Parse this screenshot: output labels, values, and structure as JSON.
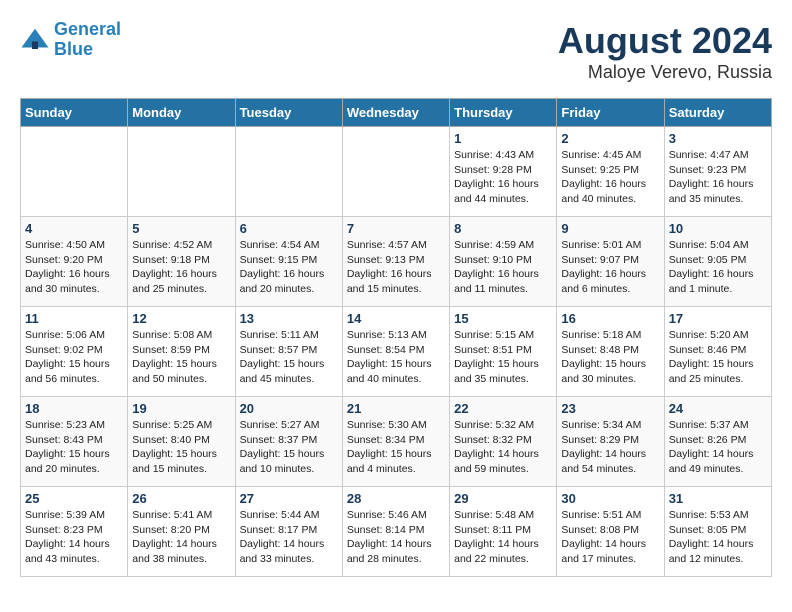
{
  "header": {
    "logo_line1": "General",
    "logo_line2": "Blue",
    "main_title": "August 2024",
    "subtitle": "Maloye Verevo, Russia"
  },
  "days_of_week": [
    "Sunday",
    "Monday",
    "Tuesday",
    "Wednesday",
    "Thursday",
    "Friday",
    "Saturday"
  ],
  "weeks": [
    [
      {
        "day": "",
        "info": ""
      },
      {
        "day": "",
        "info": ""
      },
      {
        "day": "",
        "info": ""
      },
      {
        "day": "",
        "info": ""
      },
      {
        "day": "1",
        "info": "Sunrise: 4:43 AM\nSunset: 9:28 PM\nDaylight: 16 hours\nand 44 minutes."
      },
      {
        "day": "2",
        "info": "Sunrise: 4:45 AM\nSunset: 9:25 PM\nDaylight: 16 hours\nand 40 minutes."
      },
      {
        "day": "3",
        "info": "Sunrise: 4:47 AM\nSunset: 9:23 PM\nDaylight: 16 hours\nand 35 minutes."
      }
    ],
    [
      {
        "day": "4",
        "info": "Sunrise: 4:50 AM\nSunset: 9:20 PM\nDaylight: 16 hours\nand 30 minutes."
      },
      {
        "day": "5",
        "info": "Sunrise: 4:52 AM\nSunset: 9:18 PM\nDaylight: 16 hours\nand 25 minutes."
      },
      {
        "day": "6",
        "info": "Sunrise: 4:54 AM\nSunset: 9:15 PM\nDaylight: 16 hours\nand 20 minutes."
      },
      {
        "day": "7",
        "info": "Sunrise: 4:57 AM\nSunset: 9:13 PM\nDaylight: 16 hours\nand 15 minutes."
      },
      {
        "day": "8",
        "info": "Sunrise: 4:59 AM\nSunset: 9:10 PM\nDaylight: 16 hours\nand 11 minutes."
      },
      {
        "day": "9",
        "info": "Sunrise: 5:01 AM\nSunset: 9:07 PM\nDaylight: 16 hours\nand 6 minutes."
      },
      {
        "day": "10",
        "info": "Sunrise: 5:04 AM\nSunset: 9:05 PM\nDaylight: 16 hours\nand 1 minute."
      }
    ],
    [
      {
        "day": "11",
        "info": "Sunrise: 5:06 AM\nSunset: 9:02 PM\nDaylight: 15 hours\nand 56 minutes."
      },
      {
        "day": "12",
        "info": "Sunrise: 5:08 AM\nSunset: 8:59 PM\nDaylight: 15 hours\nand 50 minutes."
      },
      {
        "day": "13",
        "info": "Sunrise: 5:11 AM\nSunset: 8:57 PM\nDaylight: 15 hours\nand 45 minutes."
      },
      {
        "day": "14",
        "info": "Sunrise: 5:13 AM\nSunset: 8:54 PM\nDaylight: 15 hours\nand 40 minutes."
      },
      {
        "day": "15",
        "info": "Sunrise: 5:15 AM\nSunset: 8:51 PM\nDaylight: 15 hours\nand 35 minutes."
      },
      {
        "day": "16",
        "info": "Sunrise: 5:18 AM\nSunset: 8:48 PM\nDaylight: 15 hours\nand 30 minutes."
      },
      {
        "day": "17",
        "info": "Sunrise: 5:20 AM\nSunset: 8:46 PM\nDaylight: 15 hours\nand 25 minutes."
      }
    ],
    [
      {
        "day": "18",
        "info": "Sunrise: 5:23 AM\nSunset: 8:43 PM\nDaylight: 15 hours\nand 20 minutes."
      },
      {
        "day": "19",
        "info": "Sunrise: 5:25 AM\nSunset: 8:40 PM\nDaylight: 15 hours\nand 15 minutes."
      },
      {
        "day": "20",
        "info": "Sunrise: 5:27 AM\nSunset: 8:37 PM\nDaylight: 15 hours\nand 10 minutes."
      },
      {
        "day": "21",
        "info": "Sunrise: 5:30 AM\nSunset: 8:34 PM\nDaylight: 15 hours\nand 4 minutes."
      },
      {
        "day": "22",
        "info": "Sunrise: 5:32 AM\nSunset: 8:32 PM\nDaylight: 14 hours\nand 59 minutes."
      },
      {
        "day": "23",
        "info": "Sunrise: 5:34 AM\nSunset: 8:29 PM\nDaylight: 14 hours\nand 54 minutes."
      },
      {
        "day": "24",
        "info": "Sunrise: 5:37 AM\nSunset: 8:26 PM\nDaylight: 14 hours\nand 49 minutes."
      }
    ],
    [
      {
        "day": "25",
        "info": "Sunrise: 5:39 AM\nSunset: 8:23 PM\nDaylight: 14 hours\nand 43 minutes."
      },
      {
        "day": "26",
        "info": "Sunrise: 5:41 AM\nSunset: 8:20 PM\nDaylight: 14 hours\nand 38 minutes."
      },
      {
        "day": "27",
        "info": "Sunrise: 5:44 AM\nSunset: 8:17 PM\nDaylight: 14 hours\nand 33 minutes."
      },
      {
        "day": "28",
        "info": "Sunrise: 5:46 AM\nSunset: 8:14 PM\nDaylight: 14 hours\nand 28 minutes."
      },
      {
        "day": "29",
        "info": "Sunrise: 5:48 AM\nSunset: 8:11 PM\nDaylight: 14 hours\nand 22 minutes."
      },
      {
        "day": "30",
        "info": "Sunrise: 5:51 AM\nSunset: 8:08 PM\nDaylight: 14 hours\nand 17 minutes."
      },
      {
        "day": "31",
        "info": "Sunrise: 5:53 AM\nSunset: 8:05 PM\nDaylight: 14 hours\nand 12 minutes."
      }
    ]
  ]
}
